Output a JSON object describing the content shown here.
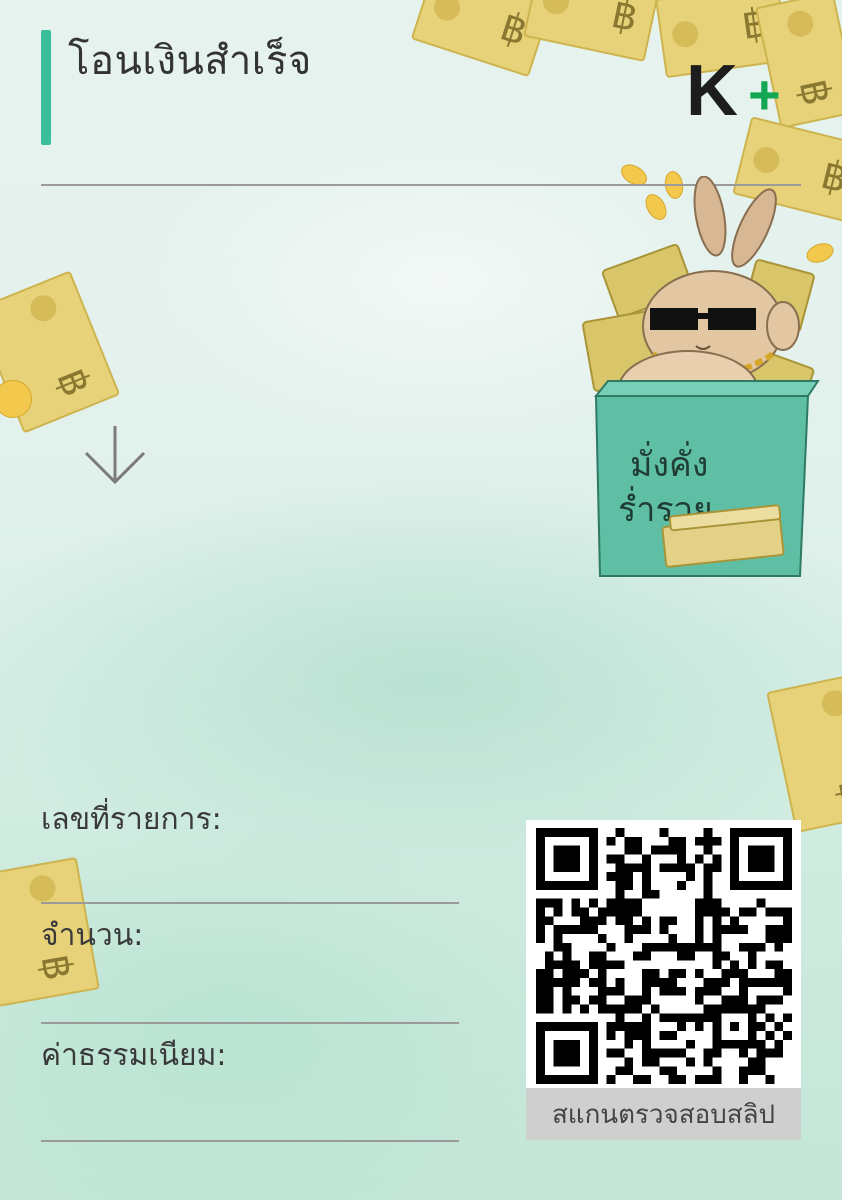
{
  "header": {
    "title": "โอนเงินสำเร็จ"
  },
  "logo": {
    "letter": "K",
    "plus": "+"
  },
  "illustration": {
    "box_text_line1": "มั่งคั่ง",
    "box_text_line2": "ร่ำรวย"
  },
  "fields": [
    {
      "label": "เลขที่รายการ:"
    },
    {
      "label": "จำนวน:"
    },
    {
      "label": "ค่าธรรมเนียม:"
    }
  ],
  "qr": {
    "caption": "สแกนตรวจสอบสลิป"
  },
  "colors": {
    "accent": "#3bbf9b",
    "logo_plus": "#13a653",
    "rule": "#9a9a9a"
  },
  "icons": {
    "arrow": "arrow-down-icon"
  }
}
